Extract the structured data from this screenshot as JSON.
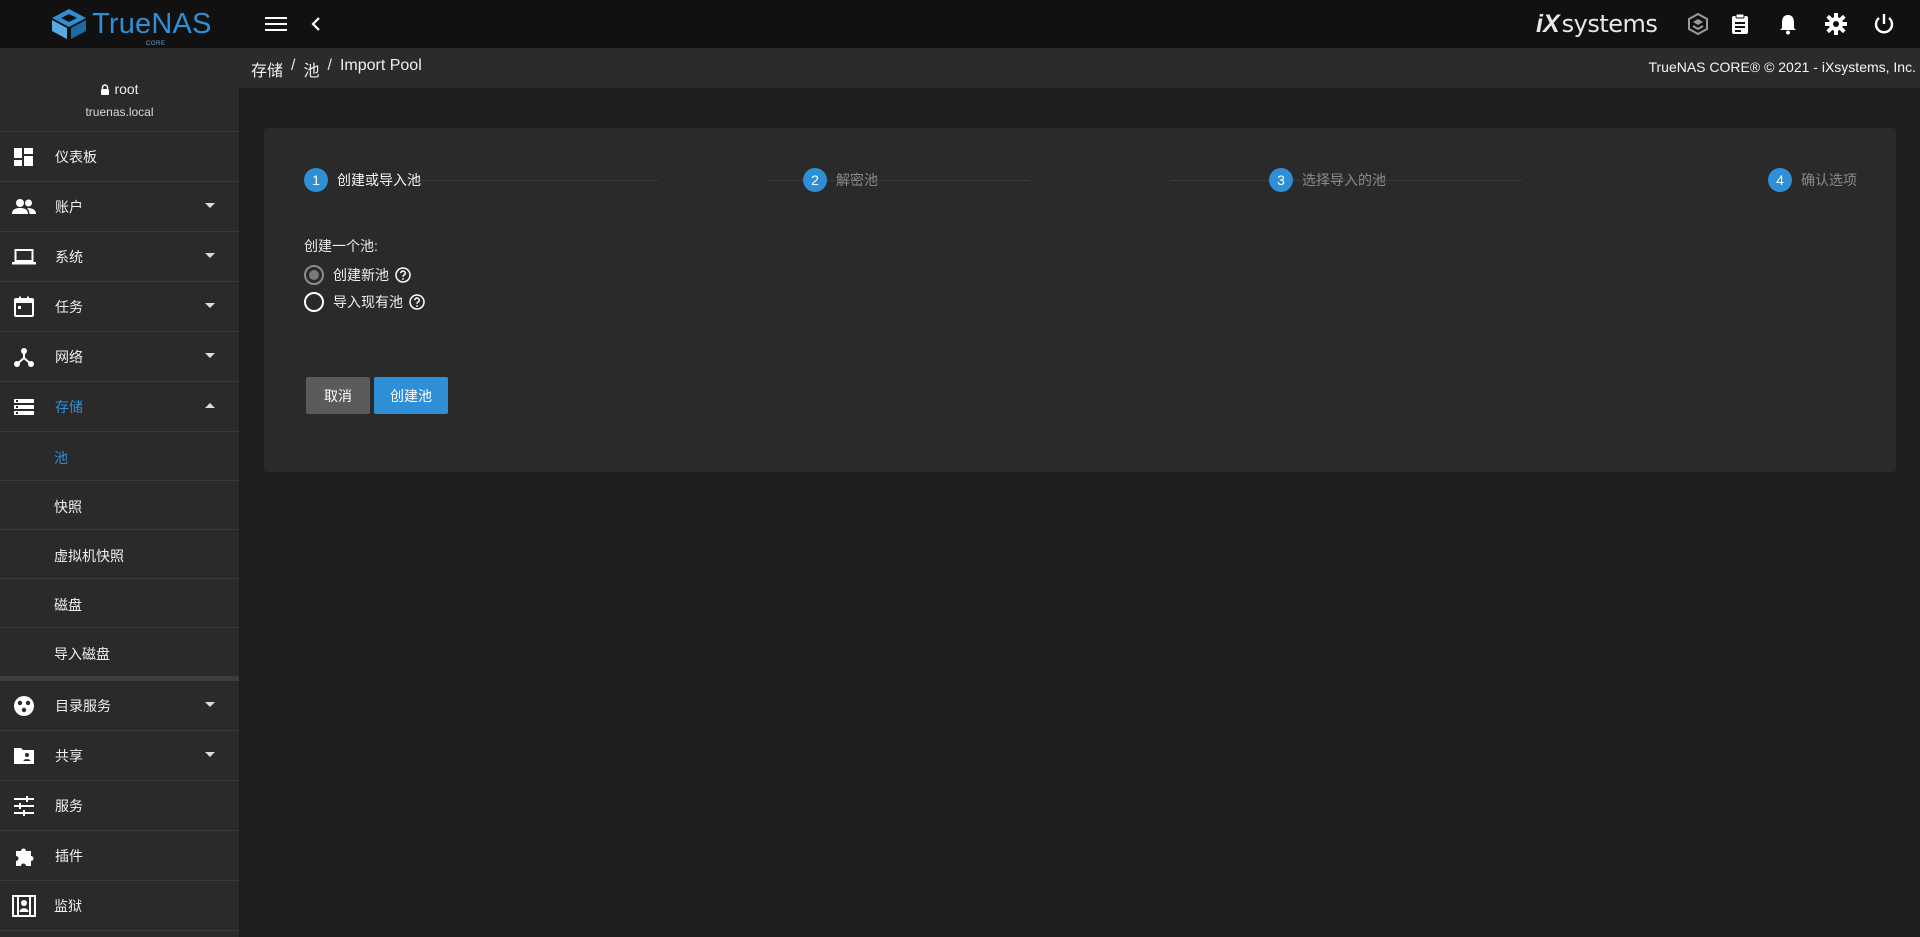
{
  "brand": {
    "name": "TrueNAS",
    "edition": "CORE"
  },
  "topbar": {
    "vendor_logo_mark": "iX",
    "vendor_logo_text": "systems",
    "icons": [
      "menu-icon",
      "chevron-left-icon",
      "truecommand-icon",
      "clipboard-icon",
      "bell-icon",
      "gear-icon",
      "power-icon"
    ]
  },
  "user": {
    "name": "root",
    "host": "truenas.local"
  },
  "sidebar": {
    "items": [
      {
        "label": "仪表板",
        "icon": "dashboard-icon"
      },
      {
        "label": "账户",
        "icon": "people-icon"
      },
      {
        "label": "系统",
        "icon": "laptop-icon"
      },
      {
        "label": "任务",
        "icon": "calendar-icon"
      },
      {
        "label": "网络",
        "icon": "network-icon"
      },
      {
        "label": "存储",
        "icon": "storage-icon"
      }
    ],
    "storage_sub": [
      {
        "label": "池"
      },
      {
        "label": "快照"
      },
      {
        "label": "虚拟机快照"
      },
      {
        "label": "磁盘"
      },
      {
        "label": "导入磁盘"
      }
    ],
    "items_after": [
      {
        "label": "目录服务",
        "icon": "directory-icon"
      },
      {
        "label": "共享",
        "icon": "folder-shared-icon"
      },
      {
        "label": "服务",
        "icon": "tune-icon"
      },
      {
        "label": "插件",
        "icon": "puzzle-icon"
      },
      {
        "label": "监狱",
        "icon": "jail-icon"
      }
    ]
  },
  "breadcrumb": {
    "items": [
      "存储",
      "池",
      "Import Pool"
    ],
    "separator": "/"
  },
  "copyright": "TrueNAS CORE® © 2021 - iXsystems, Inc.",
  "wizard": {
    "steps": [
      {
        "number": "1",
        "label": "创建或导入池"
      },
      {
        "number": "2",
        "label": "解密池"
      },
      {
        "number": "3",
        "label": "选择导入的池"
      },
      {
        "number": "4",
        "label": "确认选项"
      }
    ],
    "form_label": "创建一个池:",
    "options": [
      {
        "label": "创建新池",
        "selected": true
      },
      {
        "label": "导入现有池",
        "selected": false
      }
    ],
    "cancel_label": "取消",
    "create_label": "创建池"
  },
  "colors": {
    "accent": "#2e8fd6",
    "sidebar_bg": "#2a2a2a",
    "topbar_bg": "#111111",
    "page_bg": "#1e1e1e"
  }
}
